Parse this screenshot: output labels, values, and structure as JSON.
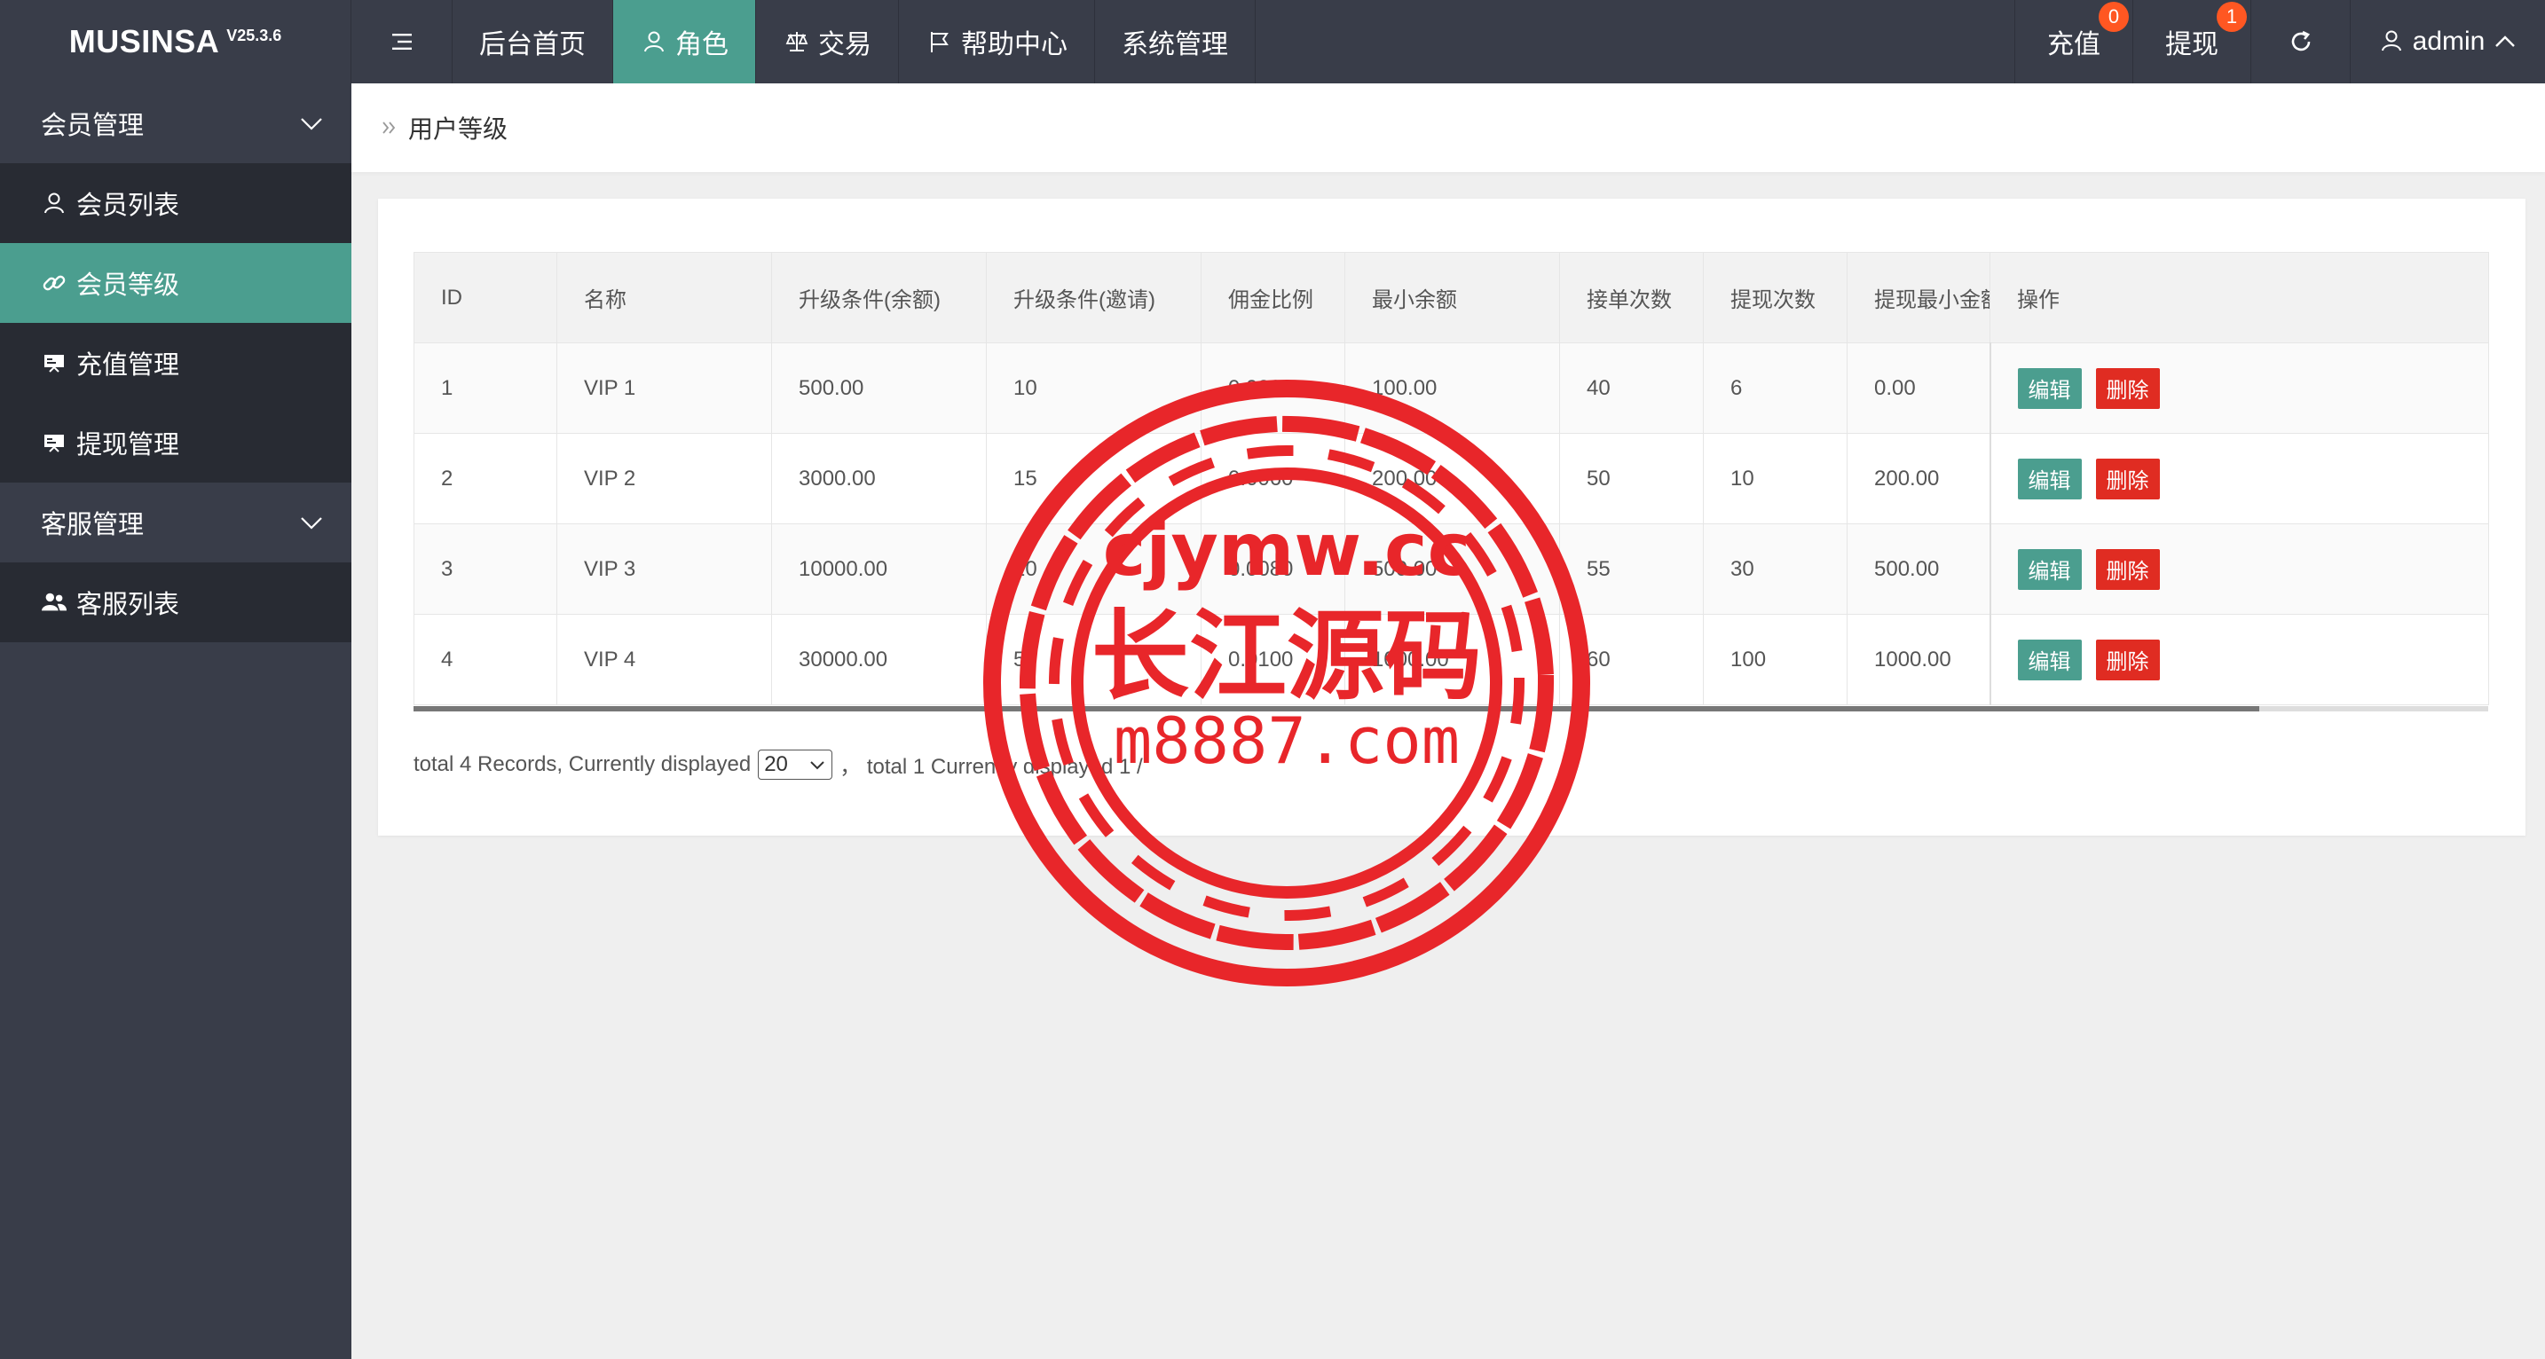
{
  "header": {
    "logo": "MUSINSA",
    "version": "V25.3.6",
    "nav": [
      {
        "label": "后台首页"
      },
      {
        "label": "角色",
        "active": true
      },
      {
        "label": "交易"
      },
      {
        "label": "帮助中心"
      },
      {
        "label": "系统管理"
      }
    ],
    "recharge": {
      "label": "充值",
      "badge": "0"
    },
    "withdraw": {
      "label": "提现",
      "badge": "1"
    },
    "user": "admin"
  },
  "sidebar": {
    "group1": "会员管理",
    "items1": [
      {
        "label": "会员列表",
        "icon": "user-icon"
      },
      {
        "label": "会员等级",
        "icon": "link-icon",
        "active": true
      },
      {
        "label": "充值管理",
        "icon": "screen-icon"
      },
      {
        "label": "提现管理",
        "icon": "screen-icon"
      }
    ],
    "group2": "客服管理",
    "items2": [
      {
        "label": "客服列表",
        "icon": "users-icon"
      }
    ]
  },
  "breadcrumb": "用户等级",
  "table": {
    "headers": [
      "ID",
      "名称",
      "升级条件(余额)",
      "升级条件(邀请)",
      "佣金比例",
      "最小余额",
      "接单次数",
      "提现次数",
      "提现最小金额",
      "操作"
    ],
    "rows": [
      [
        "1",
        "VIP 1",
        "500.00",
        "10",
        "0.0080",
        "100.00",
        "40",
        "6",
        "0.00"
      ],
      [
        "2",
        "VIP 2",
        "3000.00",
        "15",
        "0.0060",
        "200.00",
        "50",
        "10",
        "200.00"
      ],
      [
        "3",
        "VIP 3",
        "10000.00",
        "20",
        "0.0080",
        "500.00",
        "55",
        "30",
        "500.00"
      ],
      [
        "4",
        "VIP 4",
        "30000.00",
        "50",
        "0.0100",
        "1000.00",
        "60",
        "100",
        "1000.00"
      ]
    ],
    "edit_label": "编辑",
    "delete_label": "删除"
  },
  "pager": {
    "total_text": "total 4 Records,  Currently displayed",
    "page_size": "20",
    "after_text": "，  total 1 Currently displayed 1 /"
  },
  "watermark": {
    "line1": "cjymw.cc",
    "line2": "长江源码",
    "line3": "m8887.com",
    "color": "#e8262a"
  }
}
